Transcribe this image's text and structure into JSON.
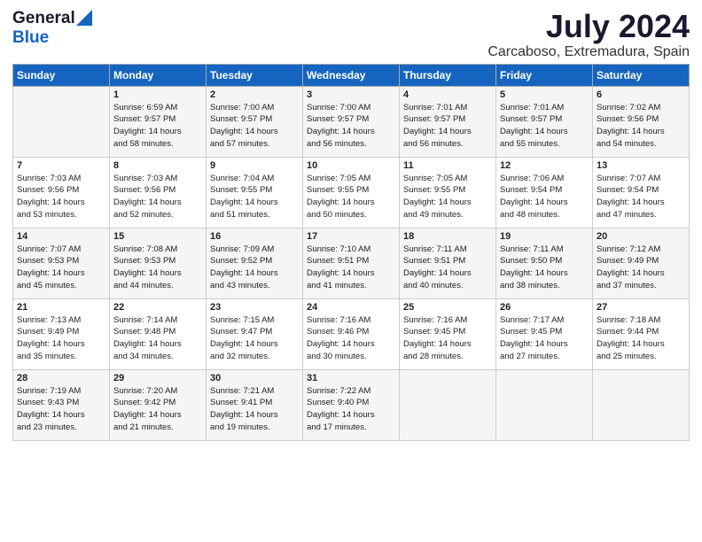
{
  "header": {
    "logo_general": "General",
    "logo_blue": "Blue",
    "month_year": "July 2024",
    "location": "Carcaboso, Extremadura, Spain"
  },
  "weekdays": [
    "Sunday",
    "Monday",
    "Tuesday",
    "Wednesday",
    "Thursday",
    "Friday",
    "Saturday"
  ],
  "weeks": [
    [
      {
        "day": "",
        "info": ""
      },
      {
        "day": "1",
        "info": "Sunrise: 6:59 AM\nSunset: 9:57 PM\nDaylight: 14 hours\nand 58 minutes."
      },
      {
        "day": "2",
        "info": "Sunrise: 7:00 AM\nSunset: 9:57 PM\nDaylight: 14 hours\nand 57 minutes."
      },
      {
        "day": "3",
        "info": "Sunrise: 7:00 AM\nSunset: 9:57 PM\nDaylight: 14 hours\nand 56 minutes."
      },
      {
        "day": "4",
        "info": "Sunrise: 7:01 AM\nSunset: 9:57 PM\nDaylight: 14 hours\nand 56 minutes."
      },
      {
        "day": "5",
        "info": "Sunrise: 7:01 AM\nSunset: 9:57 PM\nDaylight: 14 hours\nand 55 minutes."
      },
      {
        "day": "6",
        "info": "Sunrise: 7:02 AM\nSunset: 9:56 PM\nDaylight: 14 hours\nand 54 minutes."
      }
    ],
    [
      {
        "day": "7",
        "info": "Sunrise: 7:03 AM\nSunset: 9:56 PM\nDaylight: 14 hours\nand 53 minutes."
      },
      {
        "day": "8",
        "info": "Sunrise: 7:03 AM\nSunset: 9:56 PM\nDaylight: 14 hours\nand 52 minutes."
      },
      {
        "day": "9",
        "info": "Sunrise: 7:04 AM\nSunset: 9:55 PM\nDaylight: 14 hours\nand 51 minutes."
      },
      {
        "day": "10",
        "info": "Sunrise: 7:05 AM\nSunset: 9:55 PM\nDaylight: 14 hours\nand 50 minutes."
      },
      {
        "day": "11",
        "info": "Sunrise: 7:05 AM\nSunset: 9:55 PM\nDaylight: 14 hours\nand 49 minutes."
      },
      {
        "day": "12",
        "info": "Sunrise: 7:06 AM\nSunset: 9:54 PM\nDaylight: 14 hours\nand 48 minutes."
      },
      {
        "day": "13",
        "info": "Sunrise: 7:07 AM\nSunset: 9:54 PM\nDaylight: 14 hours\nand 47 minutes."
      }
    ],
    [
      {
        "day": "14",
        "info": "Sunrise: 7:07 AM\nSunset: 9:53 PM\nDaylight: 14 hours\nand 45 minutes."
      },
      {
        "day": "15",
        "info": "Sunrise: 7:08 AM\nSunset: 9:53 PM\nDaylight: 14 hours\nand 44 minutes."
      },
      {
        "day": "16",
        "info": "Sunrise: 7:09 AM\nSunset: 9:52 PM\nDaylight: 14 hours\nand 43 minutes."
      },
      {
        "day": "17",
        "info": "Sunrise: 7:10 AM\nSunset: 9:51 PM\nDaylight: 14 hours\nand 41 minutes."
      },
      {
        "day": "18",
        "info": "Sunrise: 7:11 AM\nSunset: 9:51 PM\nDaylight: 14 hours\nand 40 minutes."
      },
      {
        "day": "19",
        "info": "Sunrise: 7:11 AM\nSunset: 9:50 PM\nDaylight: 14 hours\nand 38 minutes."
      },
      {
        "day": "20",
        "info": "Sunrise: 7:12 AM\nSunset: 9:49 PM\nDaylight: 14 hours\nand 37 minutes."
      }
    ],
    [
      {
        "day": "21",
        "info": "Sunrise: 7:13 AM\nSunset: 9:49 PM\nDaylight: 14 hours\nand 35 minutes."
      },
      {
        "day": "22",
        "info": "Sunrise: 7:14 AM\nSunset: 9:48 PM\nDaylight: 14 hours\nand 34 minutes."
      },
      {
        "day": "23",
        "info": "Sunrise: 7:15 AM\nSunset: 9:47 PM\nDaylight: 14 hours\nand 32 minutes."
      },
      {
        "day": "24",
        "info": "Sunrise: 7:16 AM\nSunset: 9:46 PM\nDaylight: 14 hours\nand 30 minutes."
      },
      {
        "day": "25",
        "info": "Sunrise: 7:16 AM\nSunset: 9:45 PM\nDaylight: 14 hours\nand 28 minutes."
      },
      {
        "day": "26",
        "info": "Sunrise: 7:17 AM\nSunset: 9:45 PM\nDaylight: 14 hours\nand 27 minutes."
      },
      {
        "day": "27",
        "info": "Sunrise: 7:18 AM\nSunset: 9:44 PM\nDaylight: 14 hours\nand 25 minutes."
      }
    ],
    [
      {
        "day": "28",
        "info": "Sunrise: 7:19 AM\nSunset: 9:43 PM\nDaylight: 14 hours\nand 23 minutes."
      },
      {
        "day": "29",
        "info": "Sunrise: 7:20 AM\nSunset: 9:42 PM\nDaylight: 14 hours\nand 21 minutes."
      },
      {
        "day": "30",
        "info": "Sunrise: 7:21 AM\nSunset: 9:41 PM\nDaylight: 14 hours\nand 19 minutes."
      },
      {
        "day": "31",
        "info": "Sunrise: 7:22 AM\nSunset: 9:40 PM\nDaylight: 14 hours\nand 17 minutes."
      },
      {
        "day": "",
        "info": ""
      },
      {
        "day": "",
        "info": ""
      },
      {
        "day": "",
        "info": ""
      }
    ]
  ]
}
